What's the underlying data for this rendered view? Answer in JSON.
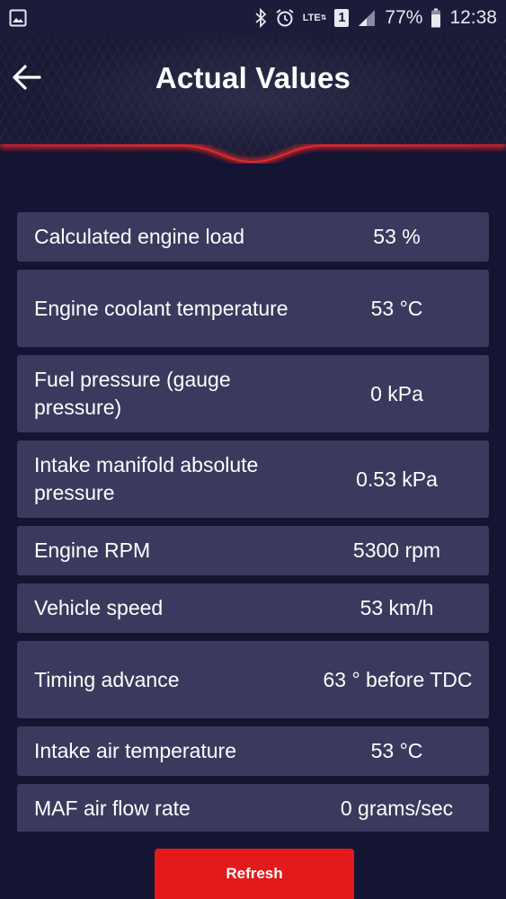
{
  "status_bar": {
    "battery_percent": "77%",
    "time": "12:38",
    "network_type": "LTE",
    "sim_slot": "1"
  },
  "header": {
    "title": "Actual Values"
  },
  "readings": [
    {
      "label": "Calculated engine load",
      "value": "53 %"
    },
    {
      "label": "Engine coolant temperature",
      "value": "53 °C"
    },
    {
      "label": "Fuel pressure (gauge pressure)",
      "value": "0 kPa"
    },
    {
      "label": "Intake manifold absolute pressure",
      "value": "0.53 kPa"
    },
    {
      "label": "Engine RPM",
      "value": "5300 rpm"
    },
    {
      "label": "Vehicle speed",
      "value": "53 km/h"
    },
    {
      "label": "Timing advance",
      "value": "63 ° before TDC"
    },
    {
      "label": "Intake air temperature",
      "value": "53 °C"
    },
    {
      "label": "MAF air flow rate",
      "value": "0 grams/sec"
    }
  ],
  "footer": {
    "refresh_label": "Refresh"
  },
  "colors": {
    "background": "#141433",
    "row": "#3a3a5e",
    "accent_red": "#e41a1a"
  },
  "icons": {
    "gallery": "image-icon",
    "bluetooth": "bluetooth-icon",
    "alarm": "alarm-clock-icon",
    "signal": "signal-icon",
    "battery": "battery-icon",
    "back": "arrow-left-icon"
  }
}
